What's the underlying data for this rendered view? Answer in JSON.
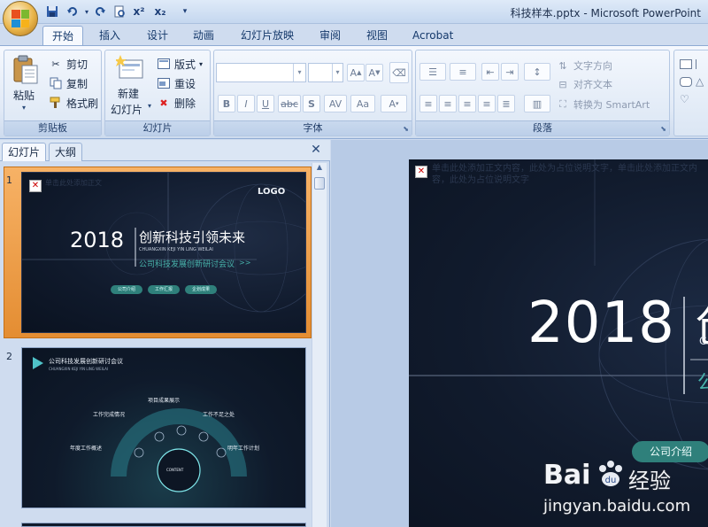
{
  "title_bar": {
    "document_title": "科技样本.pptx - Microsoft PowerPoint",
    "quick_access": [
      "save-icon",
      "undo-icon",
      "redo-icon",
      "print-preview-icon",
      "superscript-icon",
      "subscript-icon",
      "customize-icon"
    ],
    "superscript_label": "x²",
    "subscript_label": "x₂"
  },
  "ribbon_tabs": [
    "开始",
    "插入",
    "设计",
    "动画",
    "幻灯片放映",
    "审阅",
    "视图",
    "Acrobat"
  ],
  "active_tab": "开始",
  "clipboard": {
    "group_label": "剪贴板",
    "paste": "粘贴",
    "cut": "剪切",
    "copy": "复制",
    "format_painter": "格式刷"
  },
  "slides_group": {
    "group_label": "幻灯片",
    "new_slide": "新建",
    "new_slide_2": "幻灯片",
    "layout": "版式",
    "reset": "重设",
    "delete": "删除"
  },
  "font_group": {
    "group_label": "字体",
    "font_name": "",
    "font_size": "",
    "bold": "B",
    "italic": "I",
    "underline": "U",
    "strike": "abc",
    "shadow": "S",
    "spacing": "AV",
    "case": "Aa",
    "color": "A",
    "grow": "A",
    "shrink": "A"
  },
  "paragraph_group": {
    "group_label": "段落",
    "text_direction": "文字方向",
    "align_text": "对齐文本",
    "smartart": "转换为 SmartArt"
  },
  "left_pane": {
    "tab_slides": "幻灯片",
    "tab_outline": "大纲",
    "close": "✕"
  },
  "slides": [
    {
      "number": "1",
      "logo": "LOGO",
      "year": "2018",
      "heading": "创新科技引领未来",
      "pinyin": "CHUANGXIN KEJI YIN LING WEILAI",
      "subheading": "公司科技发展创新研讨会议",
      "arrows": ">>",
      "pills": [
        "公司介绍",
        "工作汇报",
        "企划成果"
      ],
      "placeholder_text": "单击此处添加正文"
    },
    {
      "number": "2",
      "title": "公司科技发展创新研讨会议",
      "subtitle": "CHUANGXIN KEJI YIN LING WEILAI",
      "labels": [
        "项目成果展示",
        "工作完成情况",
        "工作不足之处",
        "年度工作概述",
        "明年工作计划"
      ],
      "center": "CONTENT"
    }
  ],
  "main_slide": {
    "year": "2018",
    "heading_fragment": "创",
    "pinyin_fragment": "C",
    "sub_fragment": "公",
    "pill": "公司介绍",
    "placeholder_text": "单击此处添加正文内容，此处为占位说明文字，单击此处添加正文内容，此处为占位说明文字"
  },
  "watermark": {
    "brand": "Bai",
    "brand_suffix": "经验",
    "url": "jingyan.baidu.com"
  },
  "colors": {
    "accent_teal": "#3fa39d",
    "ribbon_blue": "#cfdcef",
    "slide_bg": "#111b2d",
    "thumb_selected": "#f0a250"
  }
}
